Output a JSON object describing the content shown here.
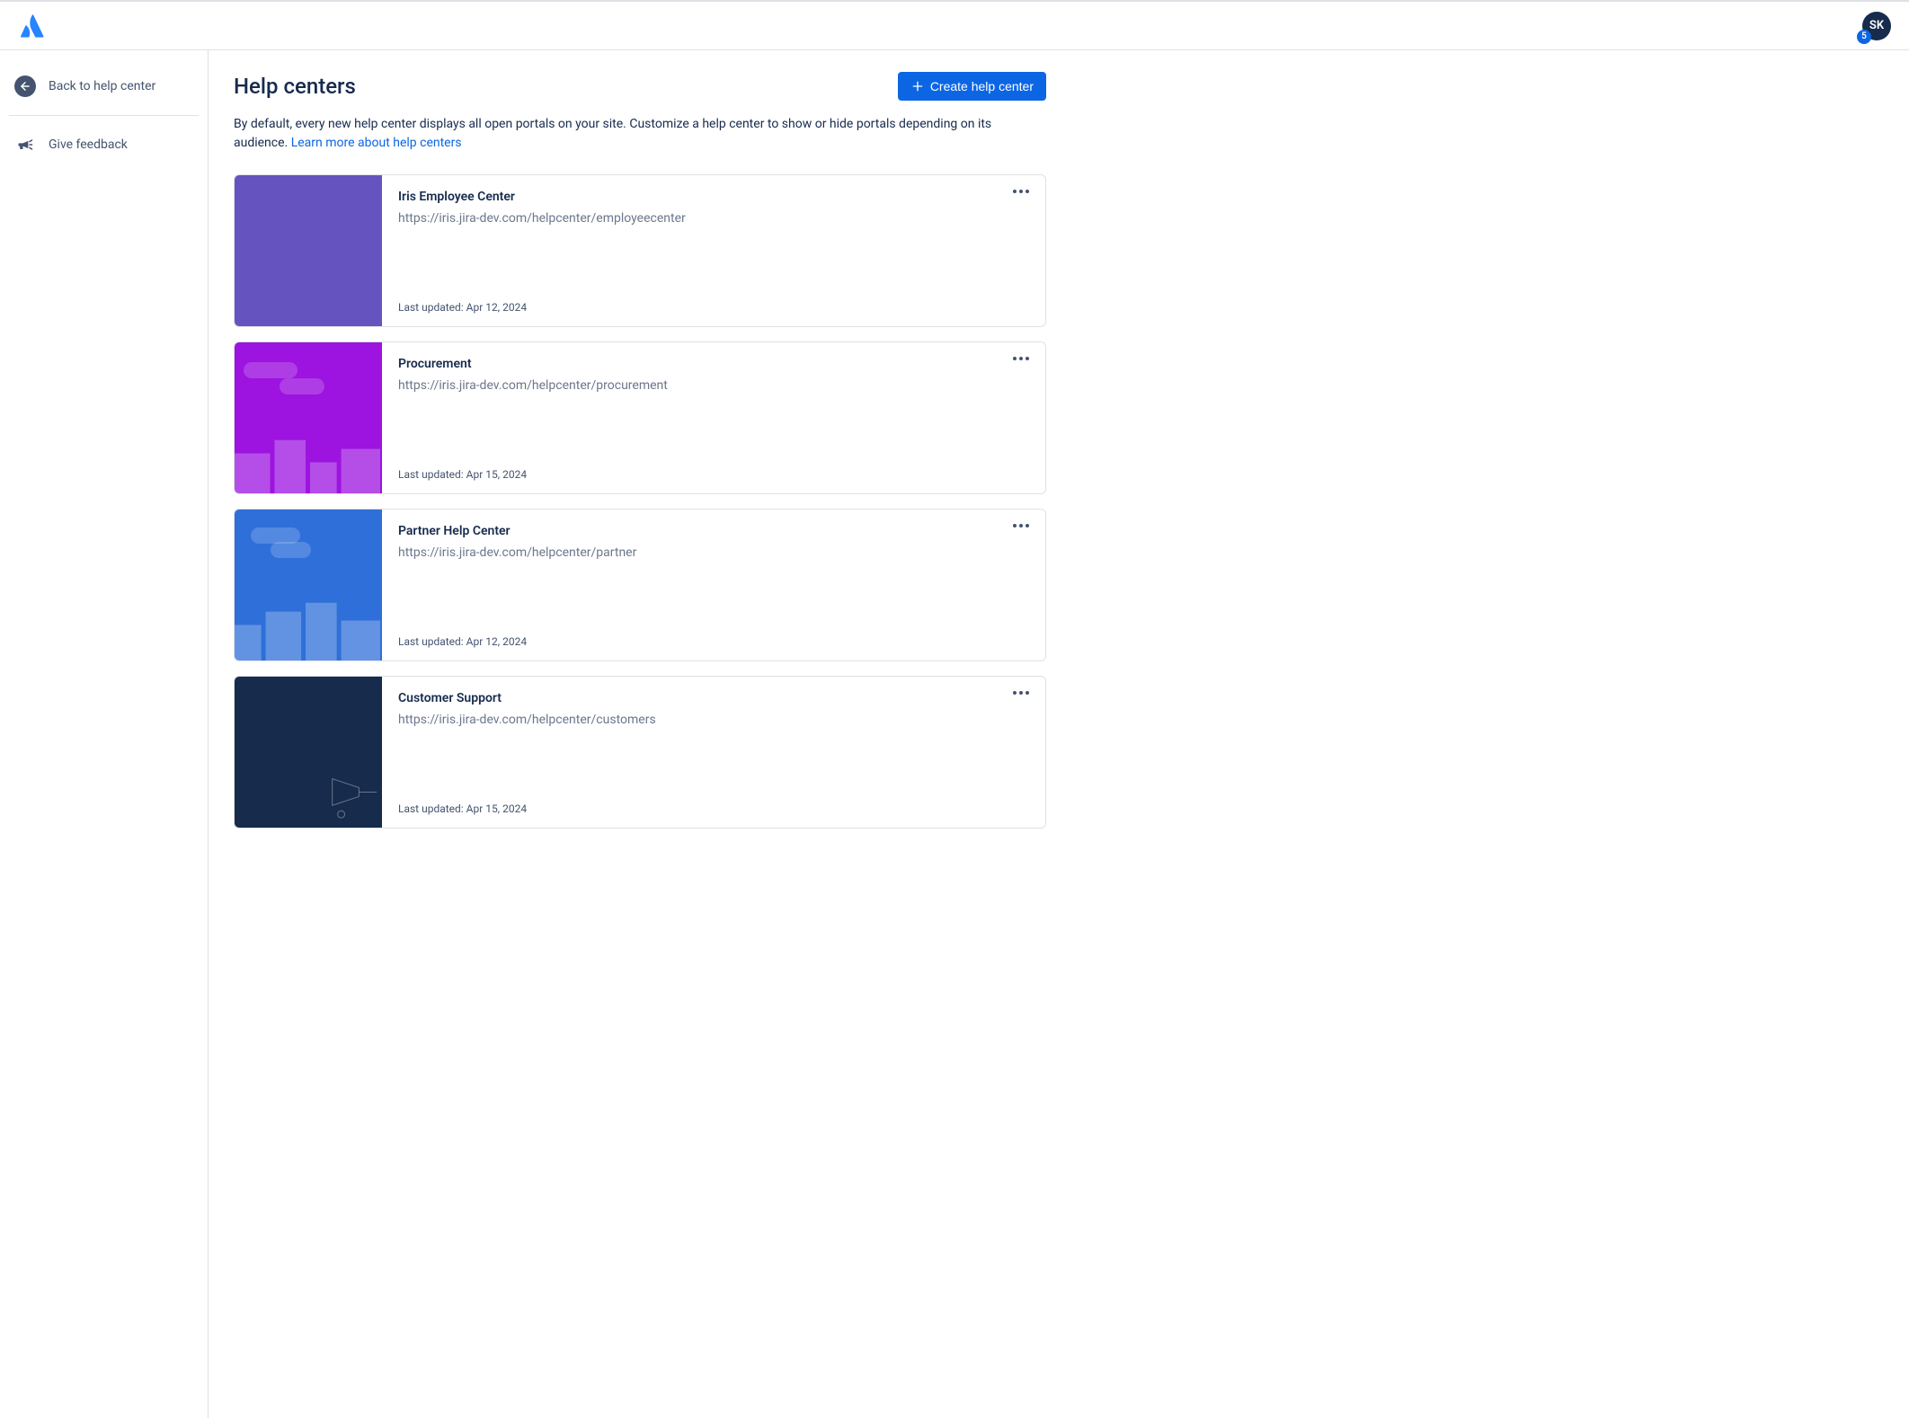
{
  "header": {
    "avatar_initials": "SK",
    "avatar_badge": "5"
  },
  "sidebar": {
    "back_label": "Back to help center",
    "feedback_label": "Give feedback"
  },
  "main": {
    "title": "Help centers",
    "create_button": "Create help center",
    "description_pre": "By default, every new help center displays all open portals on your site. Customize a help center to show or hide portals depending on its audience. ",
    "description_link": "Learn more about help centers",
    "cards": [
      {
        "title": "Iris Employee Center",
        "url": "https://iris.jira-dev.com/helpcenter/employeecenter",
        "updated": "Last updated: Apr 12, 2024"
      },
      {
        "title": "Procurement",
        "url": "https://iris.jira-dev.com/helpcenter/procurement",
        "updated": "Last updated: Apr 15, 2024"
      },
      {
        "title": "Partner Help Center",
        "url": "https://iris.jira-dev.com/helpcenter/partner",
        "updated": "Last updated: Apr 12, 2024"
      },
      {
        "title": "Customer Support",
        "url": "https://iris.jira-dev.com/helpcenter/customers",
        "updated": "Last updated: Apr 15, 2024"
      }
    ]
  }
}
